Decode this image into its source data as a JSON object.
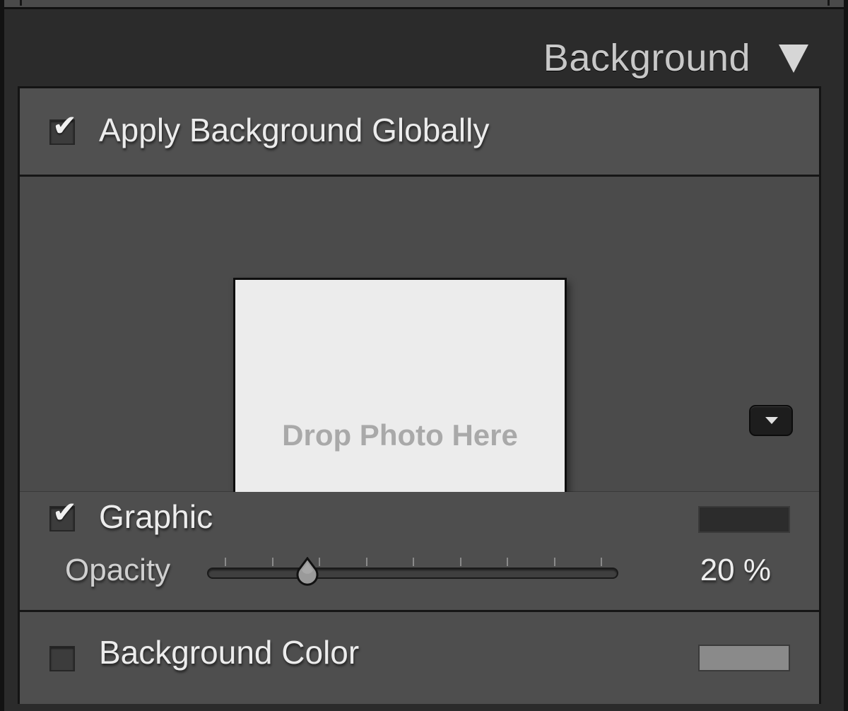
{
  "header": {
    "title": "Background",
    "collapse_icon": "triangle-down-icon"
  },
  "apply_global": {
    "label": "Apply Background Globally",
    "checked": true
  },
  "drop_zone": {
    "text": "Drop Photo Here",
    "menu_icon": "triangle-down-icon"
  },
  "graphic": {
    "label": "Graphic",
    "checked": true,
    "color": "#2c2c2c"
  },
  "opacity": {
    "label": "Opacity",
    "value": 20,
    "value_text": "20 %"
  },
  "background_color": {
    "label": "Background Color",
    "checked": false,
    "color": "#8a8a8a"
  }
}
